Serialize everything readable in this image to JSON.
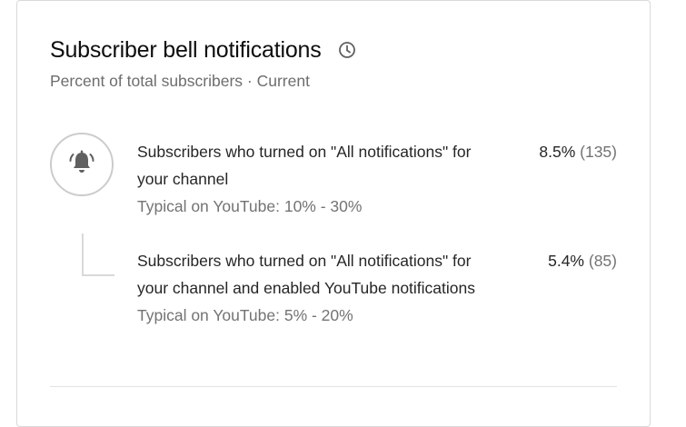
{
  "card": {
    "title": "Subscriber bell notifications",
    "subtitle": "Percent of total subscribers · Current",
    "header_icon": "clock-icon"
  },
  "metrics": [
    {
      "icon": "bell-ringing-icon",
      "description": "Subscribers who turned on \"All notifications\" for your channel",
      "typical": "Typical on YouTube: 10% - 30%",
      "percent": "8.5%",
      "count": "(135)"
    },
    {
      "description": "Subscribers who turned on \"All notifications\" for your channel and enabled YouTube notifications",
      "typical": "Typical on YouTube: 5% - 20%",
      "percent": "5.4%",
      "count": "(85)"
    }
  ]
}
